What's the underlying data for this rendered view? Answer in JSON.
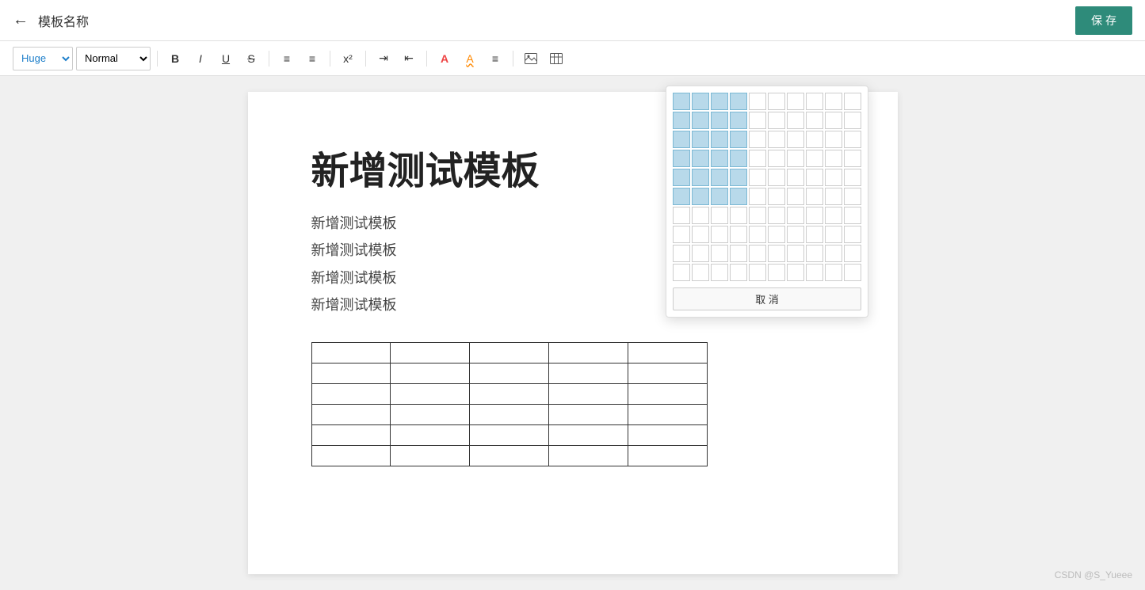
{
  "header": {
    "back_icon": "←",
    "title": "模板名称",
    "save_label": "保 存"
  },
  "toolbar": {
    "font_size_label": "Huge",
    "font_style_label": "Normal",
    "bold_label": "B",
    "italic_label": "I",
    "underline_label": "U",
    "strikethrough_label": "S",
    "ordered_list_icon": "≡",
    "unordered_list_icon": "≡",
    "superscript_label": "x²",
    "indent_increase": "→|",
    "indent_decrease": "|←",
    "font_color_label": "A",
    "highlight_label": "A̲",
    "align_label": "≡",
    "image_label": "⬜",
    "table_label": "⊞"
  },
  "editor": {
    "title": "新增测试模板",
    "paragraphs": [
      "新增测试模板",
      "新增测试模板",
      "新增测试模板",
      "新增测试模板"
    ],
    "table": {
      "rows": 6,
      "cols": 5
    }
  },
  "table_picker": {
    "rows": 10,
    "cols": 10,
    "highlight_rows": 6,
    "highlight_cols": 4,
    "cancel_label": "取 消"
  },
  "watermark": "CSDN @S_Yueee"
}
